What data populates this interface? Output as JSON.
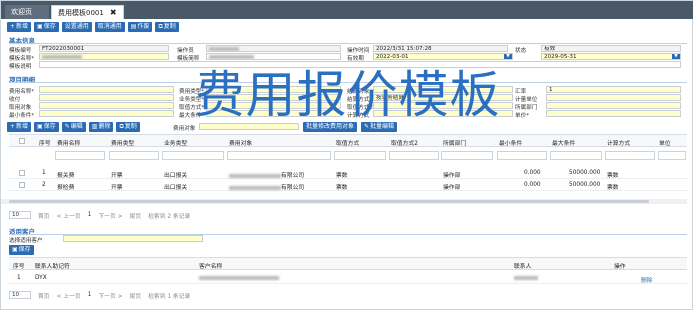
{
  "tabs": [
    {
      "label": "欢迎页"
    },
    {
      "label": "费用模板0001",
      "close": "✖"
    }
  ],
  "toolbar1": [
    "新增",
    "保存",
    "设置通用",
    "取消通用",
    "作废",
    "复制"
  ],
  "sections": {
    "basic": "基本信息",
    "items": "项目明细",
    "customers": "适用客户"
  },
  "basic": {
    "template_no_label": "模板编号",
    "template_no": "FT2022030001",
    "operator_label": "操作员",
    "op_time_label": "操作时间",
    "op_time": "2022/3/31 15:07:28",
    "status_label": "状态",
    "status": "有效",
    "template_name_label": "模板名称*",
    "short_name_label": "模板简称",
    "valid_label": "有效期",
    "valid_from": "2022-03-01",
    "valid_to": "2029-05-31",
    "remark_label": "模板说明"
  },
  "item_form": {
    "fee_name": "费用名称*",
    "fee_type": "费用类型*",
    "billing_obj": "结算对象",
    "fee_unit": "费用单价",
    "currency": "收付",
    "biz_type": "业务类型*",
    "fee_dept": "结算部门",
    "unit": "计量单位",
    "fee_obj": "取用对象",
    "calc_method": "取值方式*",
    "calc_method2": "取值方式2",
    "dept": "所属部门",
    "min_cond": "最小条件*",
    "max_cond": "最大条件*",
    "calc_way": "计算方式",
    "unit_price": "单价*",
    "rate": "汇率",
    "rate_val": "1",
    "payment": "结算方式",
    "pay_val": "按业务结算"
  },
  "toolbar2": {
    "buttons": [
      "新增",
      "保存",
      "编辑",
      "删除",
      "复制"
    ],
    "fee_obj_label": "费用对象",
    "batch_btn": "批量修改费用对象",
    "batch_edit": "批量编辑"
  },
  "grid": {
    "columns": [
      "序号",
      "费用名称",
      "费用类型",
      "业务类型",
      "费用对象",
      "取值方式",
      "取值方式2",
      "所属部门",
      "最小条件",
      "最大条件",
      "计算方式",
      "单位"
    ],
    "rows": [
      [
        "1",
        "报关费",
        "开票",
        "出口报关",
        "有限公司",
        "票数",
        "",
        "操作部",
        "0.000",
        "50000.000",
        "票数",
        ""
      ],
      [
        "2",
        "报检费",
        "开票",
        "出口报关",
        "有限公司",
        "票数",
        "",
        "操作部",
        "0.000",
        "50000.000",
        "票数",
        ""
      ]
    ],
    "pager": {
      "size": "10",
      "first": "首页",
      "prev": "< 上一页",
      "page": "1",
      "next": "下一页 >",
      "last": "尾页",
      "info": "检索到 2 条记录"
    }
  },
  "customers": {
    "select_label": "选择适用客户",
    "save_btn": "保存",
    "columns": [
      "序号",
      "联系人助记符",
      "客户名称",
      "联系人",
      "操作"
    ],
    "rows": [
      [
        "1",
        "DYX",
        "",
        "",
        "删除"
      ]
    ],
    "pager": {
      "size": "10",
      "first": "首页",
      "prev": "< 上一页",
      "page": "1",
      "next": "下一页 >",
      "last": "尾页",
      "info": "检索到 1 条记录"
    }
  },
  "overlay_title": "费用报价模板",
  "colors": {
    "accent": "#2a6bb3",
    "tabbar": "#4a5968",
    "required": "#ffffcc"
  }
}
